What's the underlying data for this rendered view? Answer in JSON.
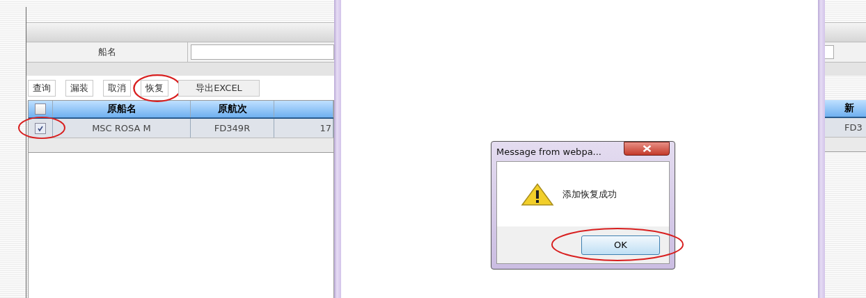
{
  "left_panel": {
    "search": {
      "label": "船名"
    },
    "toolbar": [
      {
        "label": "查询",
        "circled": false
      },
      {
        "label": "漏装",
        "circled": false
      },
      {
        "label": "取消",
        "circled": false
      },
      {
        "label": "恢复",
        "circled": true
      },
      {
        "label": "导出EXCEL",
        "circled": false
      }
    ],
    "table": {
      "header_checked": false,
      "columns": [
        "原船名",
        "原航次"
      ],
      "rows": [
        {
          "checked": true,
          "circled": true,
          "cells": [
            "MSC ROSA M",
            "FD349R",
            "17"
          ]
        }
      ]
    }
  },
  "right_panel": {
    "column": "新",
    "cell": "FD3"
  },
  "dialog": {
    "title": "Message from webpa...",
    "message": "添加恢复成功",
    "button": {
      "label": "OK",
      "circled": true
    }
  }
}
